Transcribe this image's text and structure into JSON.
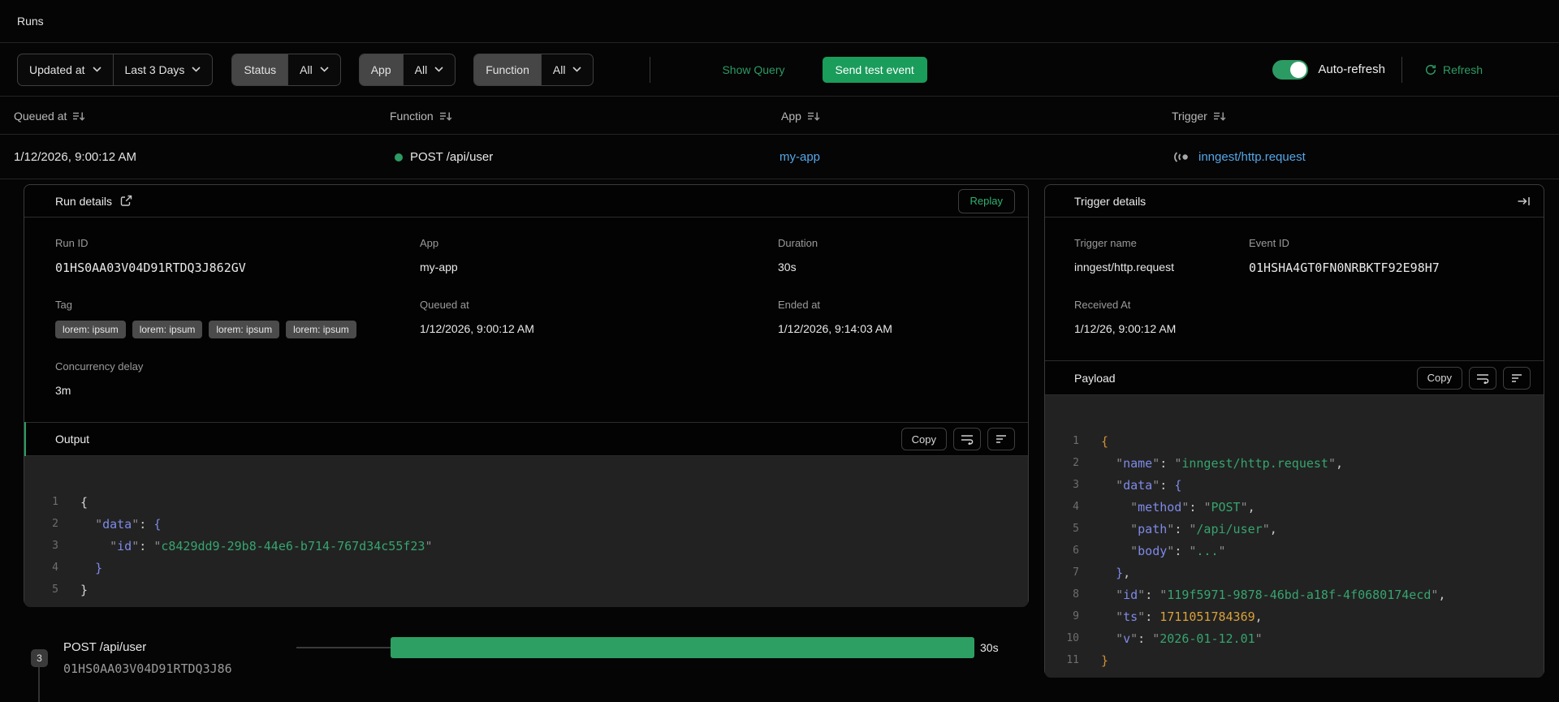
{
  "page": {
    "title": "Runs"
  },
  "filters": {
    "updated_at": "Updated at",
    "range": "Last 3 Days",
    "status_label": "Status",
    "status_value": "All",
    "app_label": "App",
    "app_value": "All",
    "function_label": "Function",
    "function_value": "All",
    "show_query": "Show Query",
    "send_test_event": "Send test event",
    "auto_refresh": "Auto-refresh",
    "refresh": "Refresh"
  },
  "table": {
    "headers": [
      "Queued at",
      "Function",
      "App",
      "Trigger"
    ],
    "row": {
      "queued_at": "1/12/2026, 9:00:12 AM",
      "function": "POST /api/user",
      "app": "my-app",
      "trigger": "inngest/http.request"
    }
  },
  "run_details": {
    "title": "Run details",
    "replay": "Replay",
    "run_id_label": "Run ID",
    "run_id": "01HS0AA03V04D91RTDQ3J862GV",
    "app_label": "App",
    "app": "my-app",
    "duration_label": "Duration",
    "duration": "30s",
    "tag_label": "Tag",
    "tags": [
      "lorem: ipsum",
      "lorem: ipsum",
      "lorem: ipsum",
      "lorem: ipsum"
    ],
    "queued_label": "Queued at",
    "queued": "1/12/2026, 9:00:12 AM",
    "ended_label": "Ended at",
    "ended": "1/12/2026, 9:14:03 AM",
    "concurrency_label": "Concurrency delay",
    "concurrency": "3m",
    "output": {
      "title": "Output",
      "copy": "Copy",
      "lines": [
        [
          [
            "{",
            "br0"
          ]
        ],
        [
          [
            "  ",
            "pun"
          ],
          [
            "\"",
            "q"
          ],
          [
            "data",
            "key"
          ],
          [
            "\"",
            "q"
          ],
          [
            ": ",
            "pun"
          ],
          [
            "{",
            "br1"
          ]
        ],
        [
          [
            "    ",
            "pun"
          ],
          [
            "\"",
            "q"
          ],
          [
            "id",
            "key"
          ],
          [
            "\"",
            "q"
          ],
          [
            ": ",
            "pun"
          ],
          [
            "\"",
            "q"
          ],
          [
            "c8429dd9-29b8-44e6-b714-767d34c55f23",
            "str"
          ],
          [
            "\"",
            "q"
          ]
        ],
        [
          [
            "  ",
            "pun"
          ],
          [
            "}",
            "br1"
          ]
        ],
        [
          [
            "}",
            "br0"
          ]
        ]
      ]
    }
  },
  "trigger_details": {
    "title": "Trigger details",
    "trigger_name_label": "Trigger name",
    "trigger_name": "inngest/http.request",
    "event_id_label": "Event ID",
    "event_id": "01HSHA4GT0FN0NRBKTF92E98H7",
    "received_label": "Received At",
    "received": "1/12/26, 9:00:12 AM",
    "payload": {
      "title": "Payload",
      "copy": "Copy",
      "lines": [
        [
          [
            "{",
            "bro"
          ]
        ],
        [
          [
            "  ",
            "pun"
          ],
          [
            "\"",
            "q"
          ],
          [
            "name",
            "key"
          ],
          [
            "\"",
            "q"
          ],
          [
            ": ",
            "pun"
          ],
          [
            "\"",
            "q"
          ],
          [
            "inngest/http.request",
            "str"
          ],
          [
            "\"",
            "q"
          ],
          [
            ",",
            "pun"
          ]
        ],
        [
          [
            "  ",
            "pun"
          ],
          [
            "\"",
            "q"
          ],
          [
            "data",
            "key"
          ],
          [
            "\"",
            "q"
          ],
          [
            ": ",
            "pun"
          ],
          [
            "{",
            "br1"
          ]
        ],
        [
          [
            "    ",
            "pun"
          ],
          [
            "\"",
            "q"
          ],
          [
            "method",
            "key"
          ],
          [
            "\"",
            "q"
          ],
          [
            ": ",
            "pun"
          ],
          [
            "\"",
            "q"
          ],
          [
            "POST",
            "str"
          ],
          [
            "\"",
            "q"
          ],
          [
            ",",
            "pun"
          ]
        ],
        [
          [
            "    ",
            "pun"
          ],
          [
            "\"",
            "q"
          ],
          [
            "path",
            "key"
          ],
          [
            "\"",
            "q"
          ],
          [
            ": ",
            "pun"
          ],
          [
            "\"",
            "q"
          ],
          [
            "/api/user",
            "str"
          ],
          [
            "\"",
            "q"
          ],
          [
            ",",
            "pun"
          ]
        ],
        [
          [
            "    ",
            "pun"
          ],
          [
            "\"",
            "q"
          ],
          [
            "body",
            "key"
          ],
          [
            "\"",
            "q"
          ],
          [
            ": ",
            "pun"
          ],
          [
            "\"",
            "q"
          ],
          [
            "...",
            "str"
          ],
          [
            "\"",
            "q"
          ]
        ],
        [
          [
            "  ",
            "pun"
          ],
          [
            "}",
            "br1"
          ],
          [
            ",",
            "pun"
          ]
        ],
        [
          [
            "  ",
            "pun"
          ],
          [
            "\"",
            "q"
          ],
          [
            "id",
            "key"
          ],
          [
            "\"",
            "q"
          ],
          [
            ": ",
            "pun"
          ],
          [
            "\"",
            "q"
          ],
          [
            "119f5971-9878-46bd-a18f-4f0680174ecd",
            "str"
          ],
          [
            "\"",
            "q"
          ],
          [
            ",",
            "pun"
          ]
        ],
        [
          [
            "  ",
            "pun"
          ],
          [
            "\"",
            "q"
          ],
          [
            "ts",
            "key"
          ],
          [
            "\"",
            "q"
          ],
          [
            ": ",
            "pun"
          ],
          [
            "1711051784369",
            "num"
          ],
          [
            ",",
            "pun"
          ]
        ],
        [
          [
            "  ",
            "pun"
          ],
          [
            "\"",
            "q"
          ],
          [
            "v",
            "key"
          ],
          [
            "\"",
            "q"
          ],
          [
            ": ",
            "pun"
          ],
          [
            "\"",
            "q"
          ],
          [
            "2026-01-12.01",
            "str"
          ],
          [
            "\"",
            "q"
          ]
        ],
        [
          [
            "}",
            "bro"
          ]
        ]
      ]
    }
  },
  "timeline": {
    "step_number": "3",
    "function": "POST /api/user",
    "run_id": "01HS0AA03V04D91RTDQ3J86",
    "duration": "30s"
  },
  "colors": {
    "accent_green": "#2c9b63",
    "bar_green": "#2d9f63",
    "link_blue": "#55a6e8",
    "link_green": "#2fb170"
  }
}
